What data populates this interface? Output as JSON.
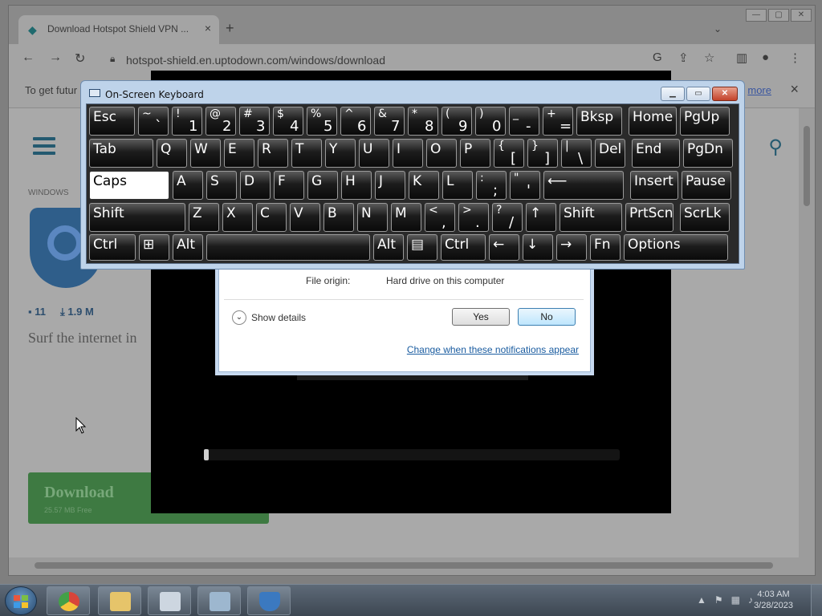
{
  "browser": {
    "tab_title": "Download Hotspot Shield VPN ...",
    "tab_close": "×",
    "new_tab": "+",
    "url": "hotspot-shield.en.uptodown.com/windows/download",
    "infobar_text": "To get futur",
    "infobar_link": "more",
    "infobar_close": "×",
    "window_buttons": [
      "—",
      "▢",
      "✕"
    ]
  },
  "page": {
    "breadcrumb": "WINDOWS",
    "stats": {
      "comments": "11",
      "size": "1.9 M"
    },
    "tagline": "Surf the internet in",
    "download_label": "Download",
    "download_meta": "25.57 MB     Free"
  },
  "uac": {
    "origin_label": "File origin:",
    "origin_value": "Hard drive on this computer",
    "show_details": "Show details",
    "yes": "Yes",
    "no": "No",
    "change_link": "Change when these notifications appear"
  },
  "osk": {
    "title": "On-Screen Keyboard",
    "keys": [
      {
        "label": "Esc"
      },
      {
        "top": "~",
        "bottom": "`"
      },
      {
        "top": "!",
        "bottom": "1"
      },
      {
        "top": "@",
        "bottom": "2"
      },
      {
        "top": "#",
        "bottom": "3"
      },
      {
        "top": "$",
        "bottom": "4"
      },
      {
        "top": "%",
        "bottom": "5"
      },
      {
        "top": "^",
        "bottom": "6"
      },
      {
        "top": "&",
        "bottom": "7"
      },
      {
        "top": "*",
        "bottom": "8"
      },
      {
        "top": "(",
        "bottom": "9"
      },
      {
        "top": ")",
        "bottom": "0"
      },
      {
        "top": "_",
        "bottom": "-"
      },
      {
        "top": "+",
        "bottom": "="
      },
      {
        "label": "Bksp"
      },
      {
        "label": "Home"
      },
      {
        "label": "PgUp"
      },
      {
        "label": "Tab"
      },
      {
        "label": "Q"
      },
      {
        "label": "W"
      },
      {
        "label": "E"
      },
      {
        "label": "R"
      },
      {
        "label": "T"
      },
      {
        "label": "Y"
      },
      {
        "label": "U"
      },
      {
        "label": "I"
      },
      {
        "label": "O"
      },
      {
        "label": "P"
      },
      {
        "top": "{",
        "bottom": "["
      },
      {
        "top": "}",
        "bottom": "]"
      },
      {
        "top": "|",
        "bottom": "\\"
      },
      {
        "label": "Del"
      },
      {
        "label": "End"
      },
      {
        "label": "PgDn"
      },
      {
        "label": "Caps"
      },
      {
        "label": "A"
      },
      {
        "label": "S"
      },
      {
        "label": "D"
      },
      {
        "label": "F"
      },
      {
        "label": "G"
      },
      {
        "label": "H"
      },
      {
        "label": "J"
      },
      {
        "label": "K"
      },
      {
        "label": "L"
      },
      {
        "top": ":",
        "bottom": ";"
      },
      {
        "top": "\"",
        "bottom": "'"
      },
      {
        "label": "⟵"
      },
      {
        "label": "Insert"
      },
      {
        "label": "Pause"
      },
      {
        "label": "Shift"
      },
      {
        "label": "Z"
      },
      {
        "label": "X"
      },
      {
        "label": "C"
      },
      {
        "label": "V"
      },
      {
        "label": "B"
      },
      {
        "label": "N"
      },
      {
        "label": "M"
      },
      {
        "top": "<",
        "bottom": ","
      },
      {
        "top": ">",
        "bottom": "."
      },
      {
        "top": "?",
        "bottom": "/"
      },
      {
        "label": "↑"
      },
      {
        "label": "Shift"
      },
      {
        "label": "PrtScn"
      },
      {
        "label": "ScrLk"
      },
      {
        "label": "Ctrl"
      },
      {
        "label": "⊞"
      },
      {
        "label": "Alt"
      },
      {
        "label": ""
      },
      {
        "label": "Alt"
      },
      {
        "label": "▤"
      },
      {
        "label": "Ctrl"
      },
      {
        "label": "←"
      },
      {
        "label": "↓"
      },
      {
        "label": "→"
      },
      {
        "label": "Fn"
      },
      {
        "label": "Options"
      }
    ]
  },
  "taskbar": {
    "time": "4:03 AM",
    "date": "3/28/2023",
    "tray_arrow": "▲"
  },
  "colors": {
    "osk_frame": "#bed3ea",
    "key_bg": "#111111",
    "download_green": "#3e7a42"
  }
}
